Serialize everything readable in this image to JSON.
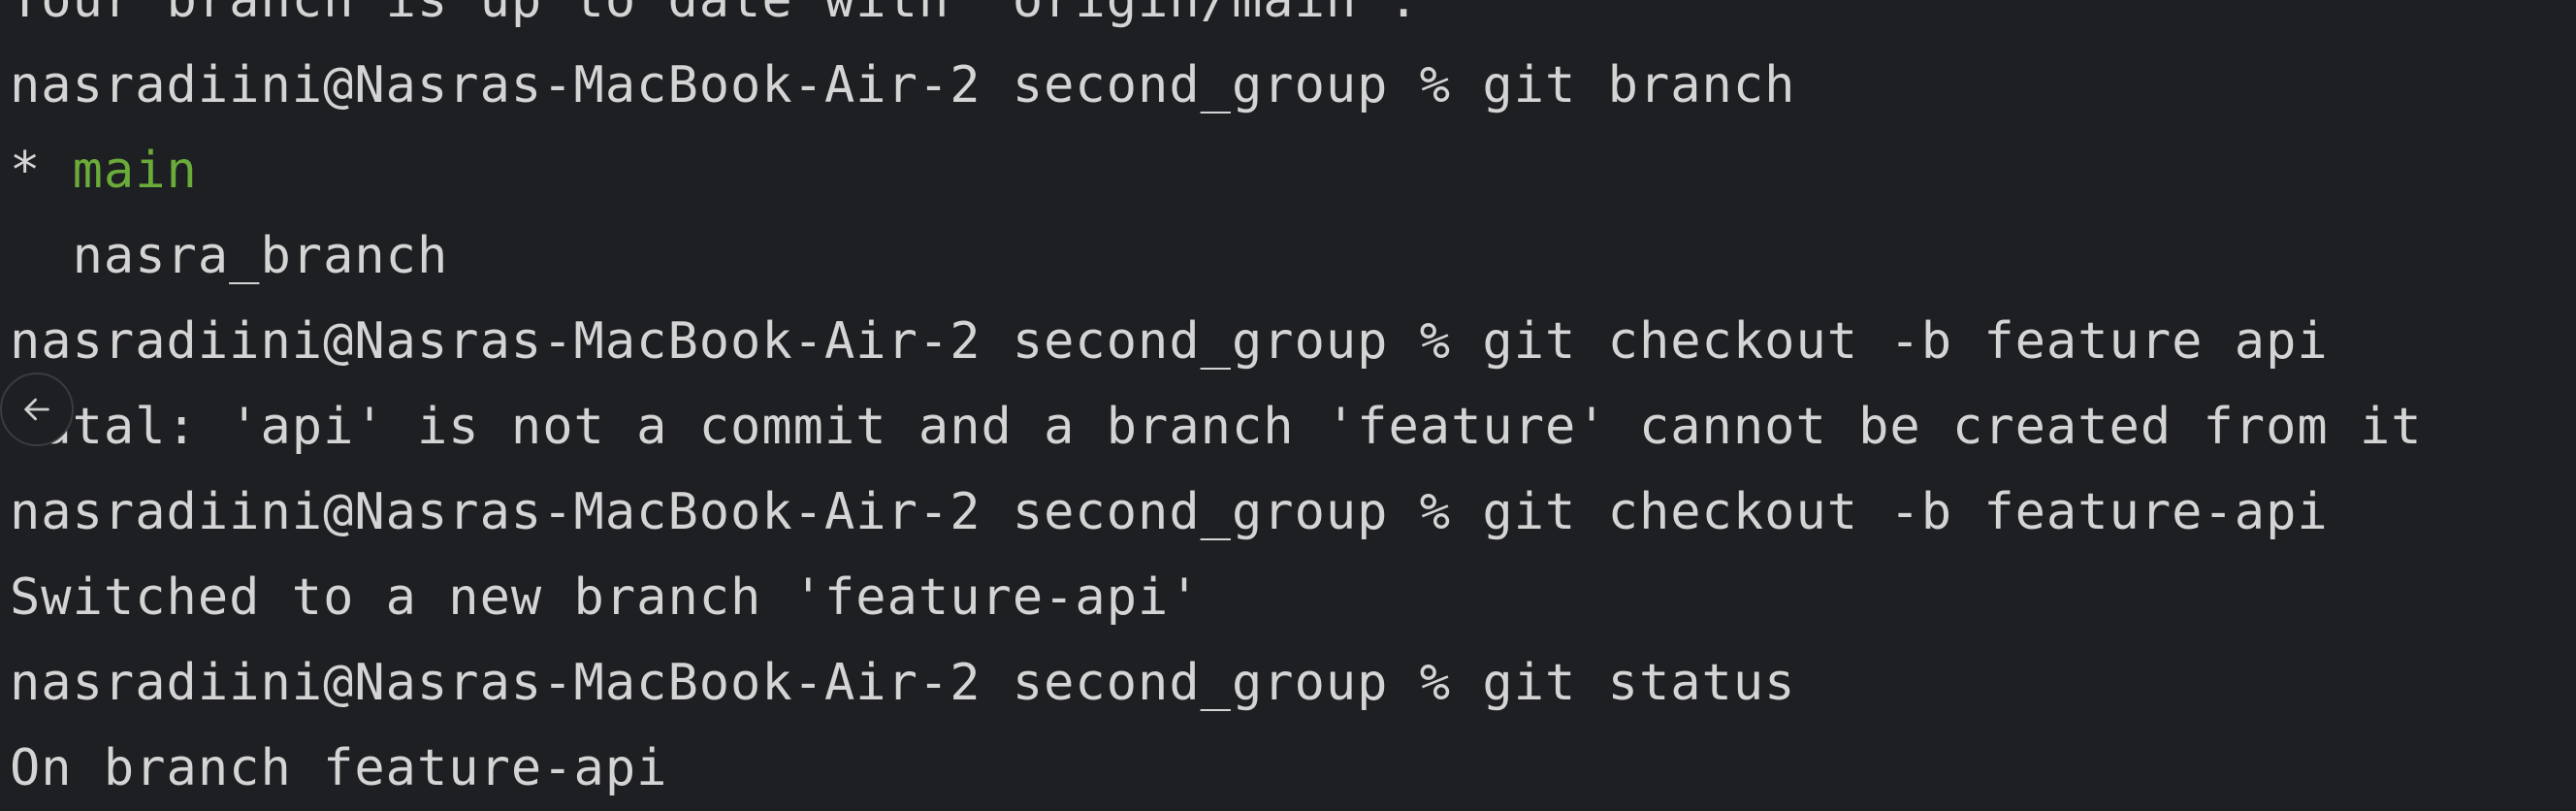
{
  "terminal": {
    "lines": [
      "Your branch is up to date with 'origin/main'.",
      "nasradiini@Nasras-MacBook-Air-2 second_group % git branch",
      "* ",
      "main",
      "  nasra_branch",
      "nasradiini@Nasras-MacBook-Air-2 second_group % git checkout -b feature api",
      "fatal: 'api' is not a commit and a branch 'feature' cannot be created from it",
      "nasradiini@Nasras-MacBook-Air-2 second_group % git checkout -b feature-api",
      "Switched to a new branch 'feature-api'",
      "nasradiini@Nasras-MacBook-Air-2 second_group % git status",
      "On branch feature-api"
    ]
  },
  "icons": {
    "back": "arrow-left-icon"
  },
  "colors": {
    "background": "#1e1f22",
    "text": "#d4d4d4",
    "current_branch": "#6aab3a"
  }
}
